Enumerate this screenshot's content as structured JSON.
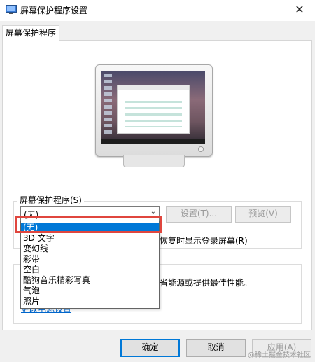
{
  "window": {
    "title": "屏幕保护程序设置",
    "close_glyph": "✕"
  },
  "tab": {
    "label": "屏幕保护程序"
  },
  "screensaver": {
    "group_label": "屏幕保护程序(S)",
    "selected": "(无)",
    "settings_label": "设置(T)...",
    "preview_label": "预览(V)",
    "resume_text": "恢复时显示登录屏幕(R)",
    "options": [
      "(无)",
      "3D 文字",
      "变幻线",
      "彩带",
      "空白",
      "酷狗音乐精彩写真",
      "气泡",
      "照片"
    ]
  },
  "power": {
    "description": "省能源或提供最佳性能。",
    "link": "更改电源设置"
  },
  "buttons": {
    "ok": "确定",
    "cancel": "取消",
    "apply": "应用(A)"
  },
  "watermark": "@稀土掘金技术社区",
  "colors": {
    "selection": "#0078d7",
    "highlight_border": "#e0463e"
  }
}
